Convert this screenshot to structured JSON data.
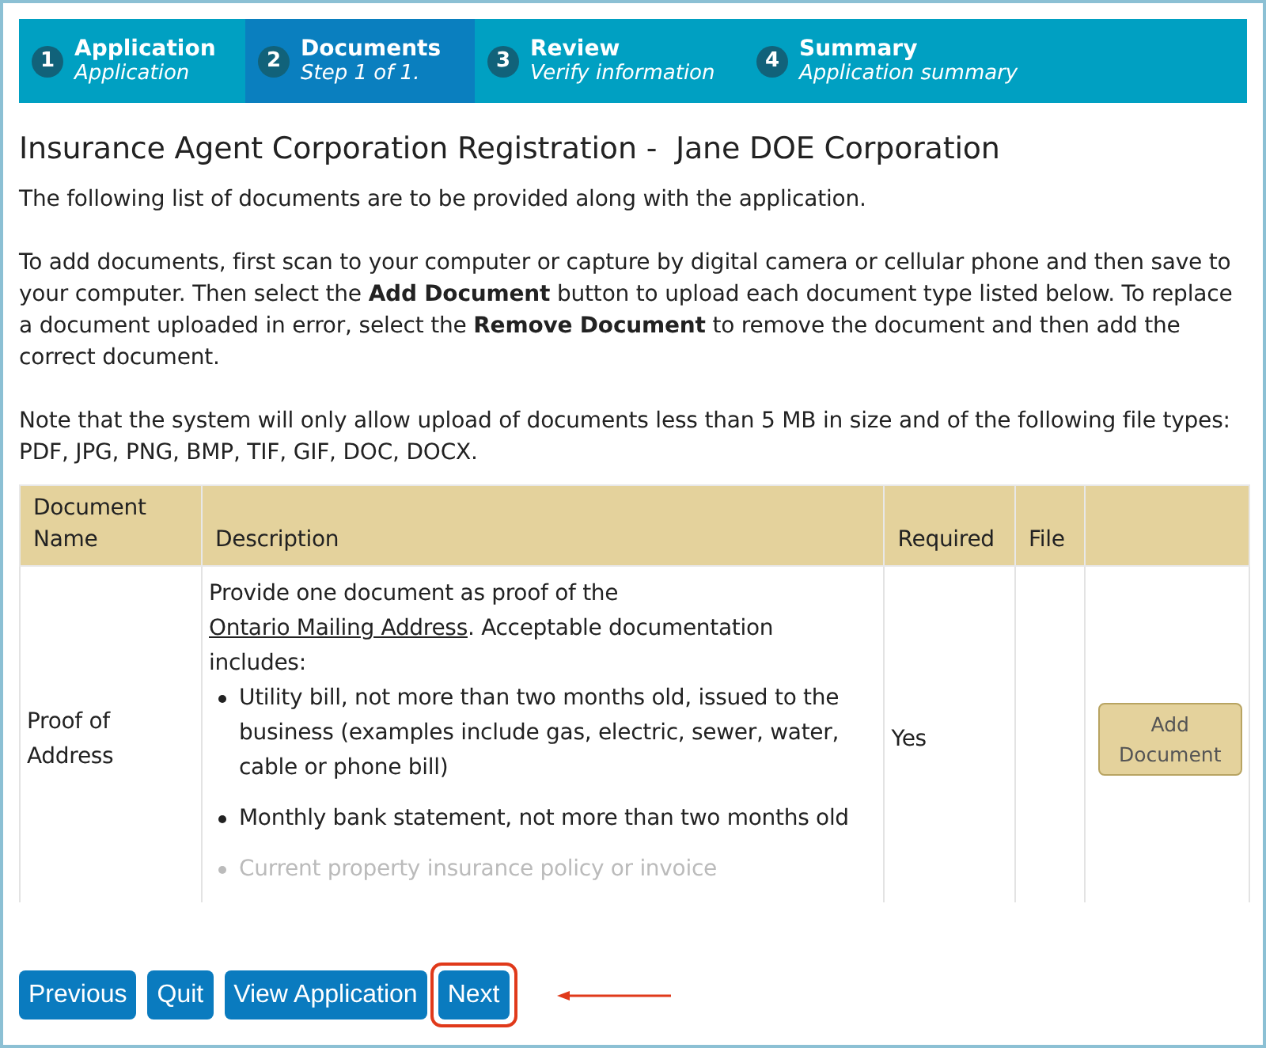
{
  "steps": [
    {
      "number": "1",
      "title": "Application",
      "subtitle": "Application",
      "selected": false
    },
    {
      "number": "2",
      "title": "Documents",
      "subtitle": "Step 1 of 1.",
      "selected": true
    },
    {
      "number": "3",
      "title": "Review",
      "subtitle": "Verify information",
      "selected": false
    },
    {
      "number": "4",
      "title": "Summary",
      "subtitle": "Application summary",
      "selected": false
    }
  ],
  "page_title": "Insurance Agent Corporation Registration -  Jane DOE Corporation",
  "intro": [
    "The following list of documents are to be provided along with the application.",
    "To add documents, first scan to your computer or capture by digital camera or cellular phone and then save to your computer. Then select the **Add Document** button to upload each document type listed below. To replace a document uploaded in error, select the **Remove Document** to remove the document and then add the correct document.",
    "Note that the system will only allow upload of documents less than 5 MB in size and of the following file types: PDF, JPG, PNG, BMP, TIF, GIF, DOC, DOCX."
  ],
  "table": {
    "columns": [
      "Document Name",
      "Description",
      "Required",
      "File"
    ],
    "rows": [
      {
        "name": "Proof of Address",
        "description": {
          "before": "Provide one document as proof of the ",
          "link": "Ontario Mailing Address",
          "after": ". Acceptable documentation includes:"
        },
        "bullets": [
          {
            "text": "Utility bill, not more than two months old, issued to the business (examples include gas, electric, sewer, water, cable or phone bill)",
            "faded": false
          },
          {
            "text": "Monthly bank statement, not more than two months old",
            "faded": false
          },
          {
            "text": "Current property insurance policy or invoice",
            "faded": true
          }
        ],
        "required": "Yes",
        "button": "Add Document"
      }
    ]
  },
  "buttons": [
    {
      "label": "Previous",
      "highlighted": false
    },
    {
      "label": "Quit",
      "highlighted": false
    },
    {
      "label": "View Application",
      "highlighted": false
    },
    {
      "label": "Next",
      "highlighted": true
    }
  ]
}
